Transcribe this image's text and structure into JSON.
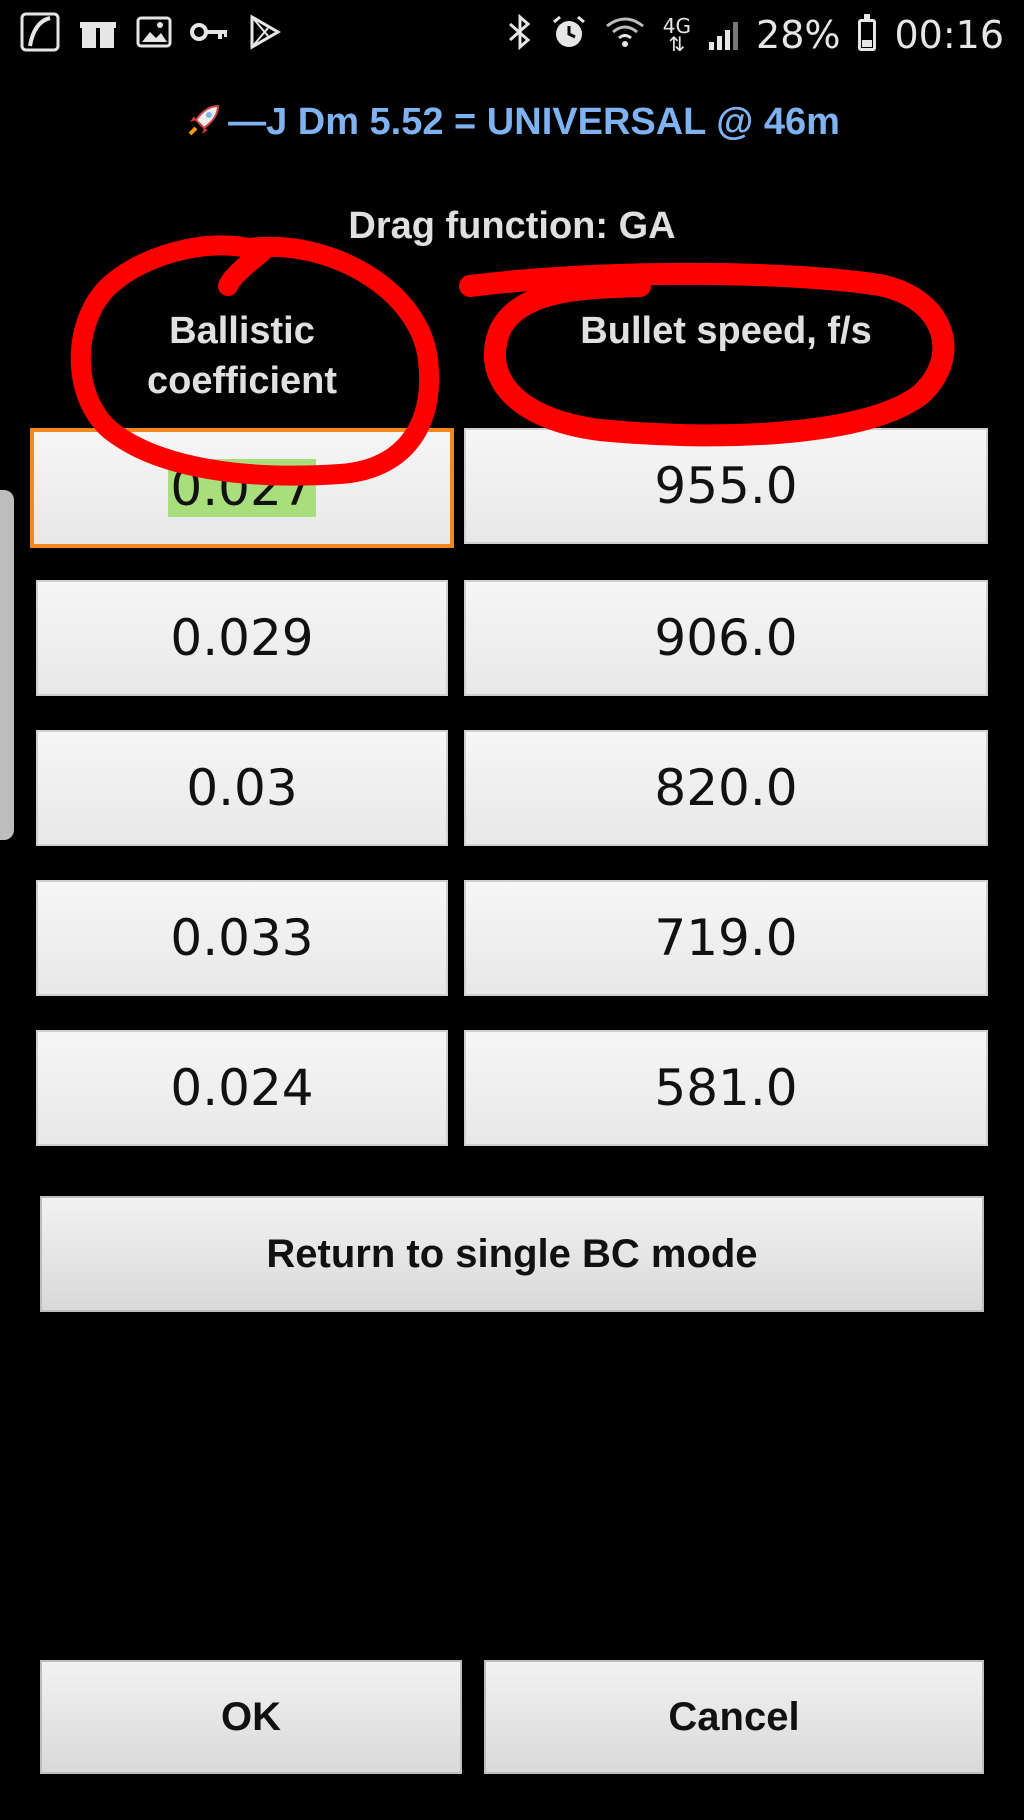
{
  "status_bar": {
    "battery_percent": "28%",
    "network_type": "4G",
    "time": "00:16",
    "left_icons": [
      "app-icon",
      "gift-icon",
      "image-icon",
      "key-icon",
      "play-store-icon"
    ],
    "right_icons": [
      "bluetooth-icon",
      "alarm-icon",
      "wifi-icon",
      "signal-icon",
      "battery-icon"
    ]
  },
  "dialog": {
    "title": "—J Dm 5.52 = UNIVERSAL @ 46m",
    "title_icon": "rocket-icon",
    "title_color": "#7fb2f0",
    "drag_function": "Drag function: GA",
    "columns": {
      "bc_line1": "Ballistic",
      "bc_line2": "coefficient",
      "speed": "Bullet speed, f/s"
    },
    "rows": [
      {
        "bc": "0.027",
        "speed": "955.0"
      },
      {
        "bc": "0.029",
        "speed": "906.0"
      },
      {
        "bc": "0.03",
        "speed": "820.0"
      },
      {
        "bc": "0.033",
        "speed": "719.0"
      },
      {
        "bc": "0.024",
        "speed": "581.0"
      }
    ],
    "focused_cell": {
      "row": 0,
      "column": "bc",
      "selection_color": "#a9de7c",
      "focus_border_color": "#f08a1e"
    },
    "return_button": "Return to single BC mode",
    "ok_button": "OK",
    "cancel_button": "Cancel"
  },
  "annotations": {
    "color": "#ff0000",
    "marks": [
      "circle-around-ballistic-coefficient",
      "circle-around-bullet-speed"
    ]
  }
}
